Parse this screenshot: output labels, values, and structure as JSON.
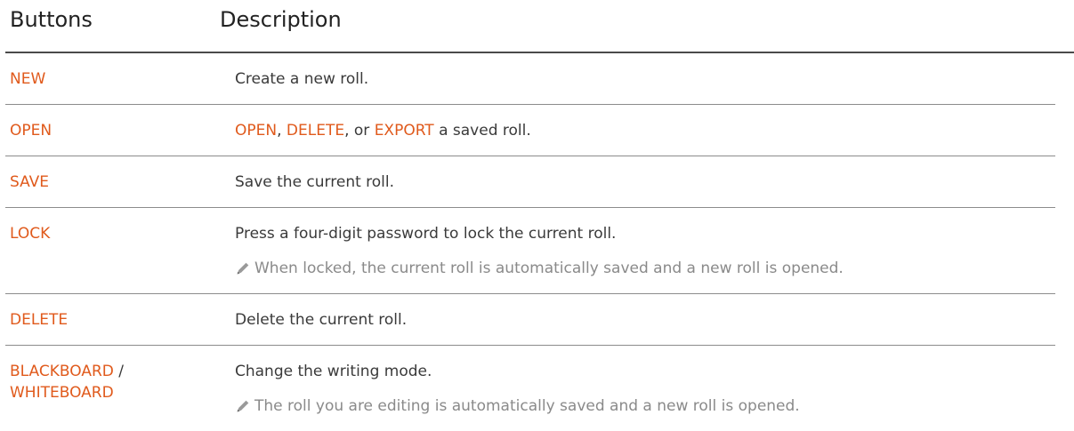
{
  "header": {
    "buttons_label": "Buttons",
    "description_label": "Description"
  },
  "rows": [
    {
      "button": "NEW",
      "description": "Create a new roll."
    },
    {
      "button": "OPEN",
      "description_parts": [
        "OPEN",
        ", ",
        "DELETE",
        ", or ",
        "EXPORT",
        " a saved roll."
      ]
    },
    {
      "button": "SAVE",
      "description": "Save the current roll."
    },
    {
      "button": "LOCK",
      "description": "Press a four-digit password to lock the current roll.",
      "note": "When locked, the current roll is automatically saved and a new roll is opened."
    },
    {
      "button": "DELETE",
      "description": "Delete the current roll."
    },
    {
      "button_line1": "BLACKBOARD",
      "button_separator": " /",
      "button_line2": "WHITEBOARD",
      "description": "Change the writing mode.",
      "note": "The roll you are editing is automatically saved and a new roll is opened."
    }
  ],
  "colors": {
    "accent": "#e05a1c",
    "text": "#3a3a3a",
    "note": "#8a8a8a"
  },
  "icons": {
    "note": "pencil-icon"
  }
}
